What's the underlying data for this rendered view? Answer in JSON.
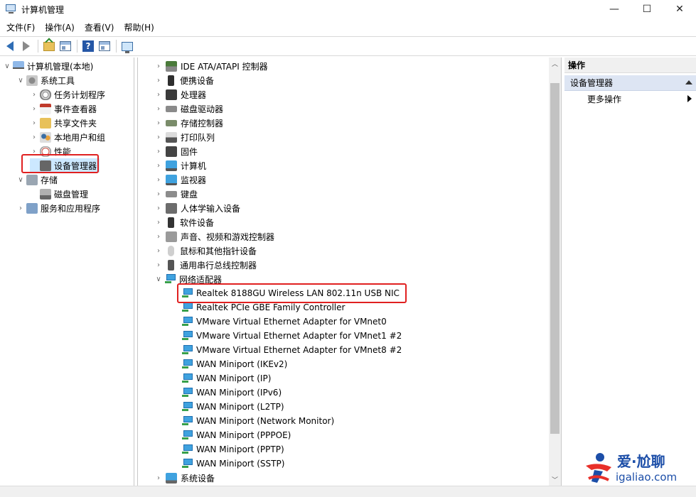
{
  "window": {
    "title": "计算机管理",
    "min": "—",
    "max": "☐",
    "close": "✕"
  },
  "menu": [
    "文件(F)",
    "操作(A)",
    "查看(V)",
    "帮助(H)"
  ],
  "toolbar": {
    "help_label": "?"
  },
  "left_tree": [
    {
      "label": "计算机管理(本地)",
      "level": 0,
      "expand": "v",
      "icon": "computer-manage-icon"
    },
    {
      "label": "系统工具",
      "level": 1,
      "expand": "v",
      "icon": "tools-icon"
    },
    {
      "label": "任务计划程序",
      "level": 2,
      "expand": ">",
      "icon": "clock-icon"
    },
    {
      "label": "事件查看器",
      "level": 2,
      "expand": ">",
      "icon": "event-viewer-icon"
    },
    {
      "label": "共享文件夹",
      "level": 2,
      "expand": ">",
      "icon": "shared-folder-icon"
    },
    {
      "label": "本地用户和组",
      "level": 2,
      "expand": ">",
      "icon": "users-icon"
    },
    {
      "label": "性能",
      "level": 2,
      "expand": ">",
      "icon": "performance-icon"
    },
    {
      "label": "设备管理器",
      "level": 2,
      "expand": "",
      "icon": "device-manager-icon",
      "selected": true
    },
    {
      "label": "存储",
      "level": 1,
      "expand": "v",
      "icon": "storage-icon"
    },
    {
      "label": "磁盘管理",
      "level": 2,
      "expand": "",
      "icon": "disk-icon"
    },
    {
      "label": "服务和应用程序",
      "level": 1,
      "expand": ">",
      "icon": "services-icon"
    }
  ],
  "device_tree": {
    "categories": [
      {
        "label": "IDE ATA/ATAPI 控制器",
        "icon": "ide-icon"
      },
      {
        "label": "便携设备",
        "icon": "portable-device-icon"
      },
      {
        "label": "处理器",
        "icon": "processor-icon"
      },
      {
        "label": "磁盘驱动器",
        "icon": "disk-drive-icon"
      },
      {
        "label": "存储控制器",
        "icon": "storage-controller-icon"
      },
      {
        "label": "打印队列",
        "icon": "printer-icon"
      },
      {
        "label": "固件",
        "icon": "firmware-icon"
      },
      {
        "label": "计算机",
        "icon": "computer-icon"
      },
      {
        "label": "监视器",
        "icon": "monitor-icon"
      },
      {
        "label": "键盘",
        "icon": "keyboard-icon"
      },
      {
        "label": "人体学输入设备",
        "icon": "hid-icon"
      },
      {
        "label": "软件设备",
        "icon": "software-device-icon"
      },
      {
        "label": "声音、视频和游戏控制器",
        "icon": "sound-icon"
      },
      {
        "label": "鼠标和其他指针设备",
        "icon": "mouse-icon"
      },
      {
        "label": "通用串行总线控制器",
        "icon": "usb-icon"
      }
    ],
    "network": {
      "label": "网络适配器",
      "adapters": [
        "Realtek 8188GU Wireless LAN 802.11n USB NIC",
        "Realtek PCIe GBE Family Controller",
        "VMware Virtual Ethernet Adapter for VMnet0",
        "VMware Virtual Ethernet Adapter for VMnet1 #2",
        "VMware Virtual Ethernet Adapter for VMnet8 #2",
        "WAN Miniport (IKEv2)",
        "WAN Miniport (IP)",
        "WAN Miniport (IPv6)",
        "WAN Miniport (L2TP)",
        "WAN Miniport (Network Monitor)",
        "WAN Miniport (PPPOE)",
        "WAN Miniport (PPTP)",
        "WAN Miniport (SSTP)"
      ]
    },
    "tail": {
      "label": "系统设备",
      "icon": "system-device-icon"
    }
  },
  "actions": {
    "header": "操作",
    "section": "设备管理器",
    "more": "更多操作"
  },
  "watermark": {
    "title": "爱·尬聊",
    "url": "igaliao.com"
  },
  "colors": {
    "highlight": "#e02020",
    "selection": "#cce8ff",
    "actions_section": "#dde5f3",
    "watermark": "#1c4ea8"
  }
}
